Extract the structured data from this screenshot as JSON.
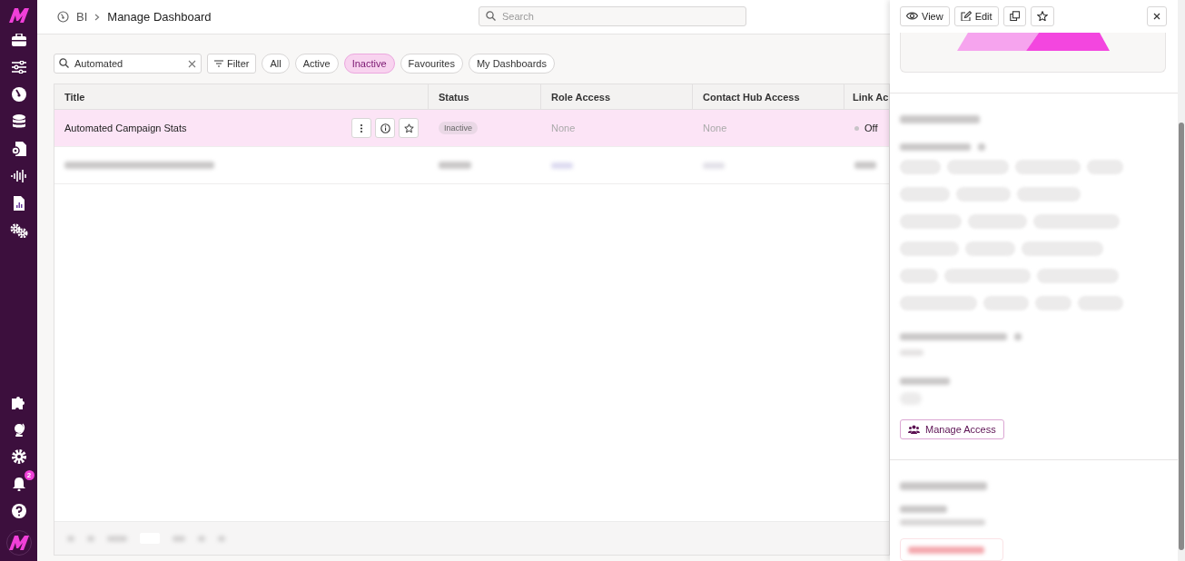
{
  "sidebar": {
    "notification_count": "2"
  },
  "breadcrumb": [
    "BI",
    "Manage Dashboard"
  ],
  "search": {
    "placeholder": "Search"
  },
  "filter_field": {
    "value": "Automated"
  },
  "filter_button": "Filter",
  "chips": [
    {
      "label": "All",
      "selected": false
    },
    {
      "label": "Active",
      "selected": false
    },
    {
      "label": "Inactive",
      "selected": true
    },
    {
      "label": "Favourites",
      "selected": false
    },
    {
      "label": "My Dashboards",
      "selected": false
    }
  ],
  "table": {
    "columns": [
      "Title",
      "Status",
      "Role Access",
      "Contact Hub Access",
      "Link Ac"
    ],
    "rows": [
      {
        "title": "Automated Campaign Stats",
        "status": "Inactive",
        "role_access": "None",
        "contact_hub_access": "None",
        "link_access": "Off",
        "link_on": false,
        "selected": true
      }
    ]
  },
  "panel": {
    "buttons": [
      {
        "kind": "view",
        "label": "View"
      },
      {
        "kind": "edit",
        "label": "Edit"
      },
      {
        "kind": "copy"
      },
      {
        "kind": "star"
      }
    ],
    "manage_access_button": "Manage Access"
  }
}
